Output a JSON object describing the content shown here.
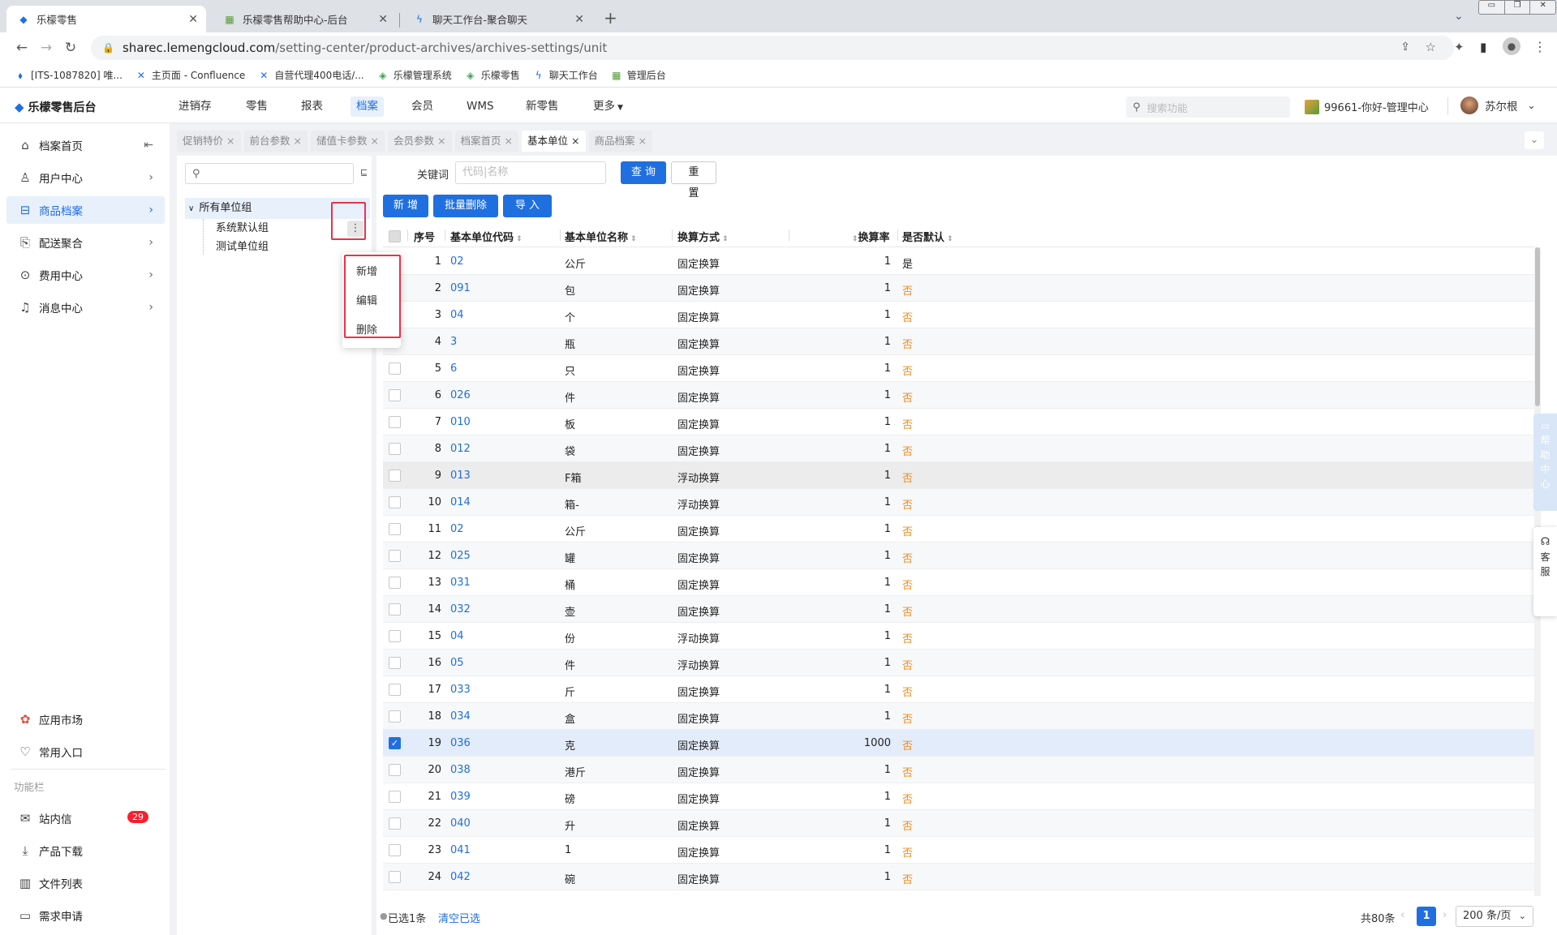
{
  "browser": {
    "tabs": [
      {
        "title": "乐檬零售",
        "icon": "lemeng-icon"
      },
      {
        "title": "乐檬零售帮助中心-后台",
        "icon": "help-doc-icon"
      },
      {
        "title": "聊天工作台-聚合聊天",
        "icon": "chat-icon"
      }
    ],
    "url_domain": "sharec.lemengcloud.com",
    "url_path": "/setting-center/product-archives/archives-settings/unit",
    "bookmarks": [
      {
        "label": "[ITS-1087820] 唯...",
        "icon": "jira-icon"
      },
      {
        "label": "主页面 - Confluence",
        "icon": "confluence-icon"
      },
      {
        "label": "自营代理400电话/...",
        "icon": "confluence-icon"
      },
      {
        "label": "乐檬管理系统",
        "icon": "lemeng-green-icon"
      },
      {
        "label": "乐檬零售",
        "icon": "lemeng-green-icon"
      },
      {
        "label": "聊天工作台",
        "icon": "chat-icon"
      },
      {
        "label": "管理后台",
        "icon": "admin-icon"
      }
    ]
  },
  "header": {
    "logo": "乐檬零售后台",
    "nav": [
      "进销存",
      "零售",
      "报表",
      "档案",
      "会员",
      "WMS",
      "新零售",
      "更多"
    ],
    "active_nav": "档案",
    "search_placeholder": "搜索功能",
    "store": "99661-你好-管理中心",
    "user": "苏尔根"
  },
  "sidebar": {
    "items": [
      {
        "label": "档案首页",
        "icon": "home-icon"
      },
      {
        "label": "用户中心",
        "icon": "user-icon"
      },
      {
        "label": "商品档案",
        "icon": "product-icon"
      },
      {
        "label": "配送聚合",
        "icon": "delivery-icon"
      },
      {
        "label": "费用中心",
        "icon": "money-icon"
      },
      {
        "label": "消息中心",
        "icon": "bell-icon"
      }
    ],
    "bottom": [
      {
        "label": "应用市场",
        "icon": "app-market-icon"
      },
      {
        "label": "常用入口",
        "icon": "heart-icon"
      }
    ],
    "section_label": "功能栏",
    "tools": [
      {
        "label": "站内信",
        "icon": "mail-icon",
        "badge": "29"
      },
      {
        "label": "产品下载",
        "icon": "download-icon"
      },
      {
        "label": "文件列表",
        "icon": "chart-icon"
      },
      {
        "label": "需求申请",
        "icon": "request-icon"
      }
    ]
  },
  "page_tabs": [
    {
      "label": "促销特价",
      "active": false
    },
    {
      "label": "前台参数",
      "active": false
    },
    {
      "label": "储值卡参数",
      "active": false
    },
    {
      "label": "会员参数",
      "active": false
    },
    {
      "label": "档案首页",
      "active": false
    },
    {
      "label": "基本单位",
      "active": true
    },
    {
      "label": "商品档案",
      "active": false
    }
  ],
  "tree": {
    "root": "所有单位组",
    "children": [
      "系统默认组",
      "测试单位组"
    ],
    "context_menu": [
      "新增",
      "编辑",
      "删除"
    ]
  },
  "toolbar": {
    "keyword_label": "关键词",
    "keyword_placeholder": "代码|名称",
    "query": "查 询",
    "reset": "重 置",
    "add": "新 增",
    "batch_delete": "批量删除",
    "import": "导 入"
  },
  "table": {
    "columns": [
      "序号",
      "基本单位代码",
      "基本单位名称",
      "换算方式",
      "换算率",
      "是否默认"
    ],
    "rows": [
      {
        "no": "1",
        "code": "02",
        "name": "公斤",
        "method": "固定换算",
        "rate": "1",
        "default": "是"
      },
      {
        "no": "2",
        "code": "091",
        "name": "包",
        "method": "固定换算",
        "rate": "1",
        "default": "否"
      },
      {
        "no": "3",
        "code": "04",
        "name": "个",
        "method": "固定换算",
        "rate": "1",
        "default": "否"
      },
      {
        "no": "4",
        "code": "3",
        "name": "瓶",
        "method": "固定换算",
        "rate": "1",
        "default": "否"
      },
      {
        "no": "5",
        "code": "6",
        "name": "只",
        "method": "固定换算",
        "rate": "1",
        "default": "否"
      },
      {
        "no": "6",
        "code": "026",
        "name": "件",
        "method": "固定换算",
        "rate": "1",
        "default": "否"
      },
      {
        "no": "7",
        "code": "010",
        "name": "板",
        "method": "固定换算",
        "rate": "1",
        "default": "否"
      },
      {
        "no": "8",
        "code": "012",
        "name": "袋",
        "method": "固定换算",
        "rate": "1",
        "default": "否"
      },
      {
        "no": "9",
        "code": "013",
        "name": "F箱",
        "method": "浮动换算",
        "rate": "1",
        "default": "否"
      },
      {
        "no": "10",
        "code": "014",
        "name": "箱-",
        "method": "浮动换算",
        "rate": "1",
        "default": "否"
      },
      {
        "no": "11",
        "code": "02",
        "name": "公斤",
        "method": "固定换算",
        "rate": "1",
        "default": "否"
      },
      {
        "no": "12",
        "code": "025",
        "name": "罐",
        "method": "固定换算",
        "rate": "1",
        "default": "否"
      },
      {
        "no": "13",
        "code": "031",
        "name": "桶",
        "method": "固定换算",
        "rate": "1",
        "default": "否"
      },
      {
        "no": "14",
        "code": "032",
        "name": "壶",
        "method": "固定换算",
        "rate": "1",
        "default": "否"
      },
      {
        "no": "15",
        "code": "04",
        "name": "份",
        "method": "浮动换算",
        "rate": "1",
        "default": "否"
      },
      {
        "no": "16",
        "code": "05",
        "name": "件",
        "method": "浮动换算",
        "rate": "1",
        "default": "否"
      },
      {
        "no": "17",
        "code": "033",
        "name": "斤",
        "method": "固定换算",
        "rate": "1",
        "default": "否"
      },
      {
        "no": "18",
        "code": "034",
        "name": "盒",
        "method": "固定换算",
        "rate": "1",
        "default": "否"
      },
      {
        "no": "19",
        "code": "036",
        "name": "克",
        "method": "固定换算",
        "rate": "1000",
        "default": "否",
        "checked": true
      },
      {
        "no": "20",
        "code": "038",
        "name": "港斤",
        "method": "固定换算",
        "rate": "1",
        "default": "否"
      },
      {
        "no": "21",
        "code": "039",
        "name": "磅",
        "method": "固定换算",
        "rate": "1",
        "default": "否"
      },
      {
        "no": "22",
        "code": "040",
        "name": "升",
        "method": "固定换算",
        "rate": "1",
        "default": "否"
      },
      {
        "no": "23",
        "code": "041",
        "name": "1",
        "method": "固定换算",
        "rate": "1",
        "default": "否"
      },
      {
        "no": "24",
        "code": "042",
        "name": "碗",
        "method": "固定换算",
        "rate": "1",
        "default": "否"
      }
    ]
  },
  "footer": {
    "selected": "已选1条",
    "clear": "清空已选",
    "total": "共80条",
    "page": "1",
    "page_size": "200 条/页"
  },
  "float": {
    "help": [
      "帮",
      "助",
      "中",
      "心"
    ],
    "kefu": [
      "客",
      "服"
    ]
  }
}
